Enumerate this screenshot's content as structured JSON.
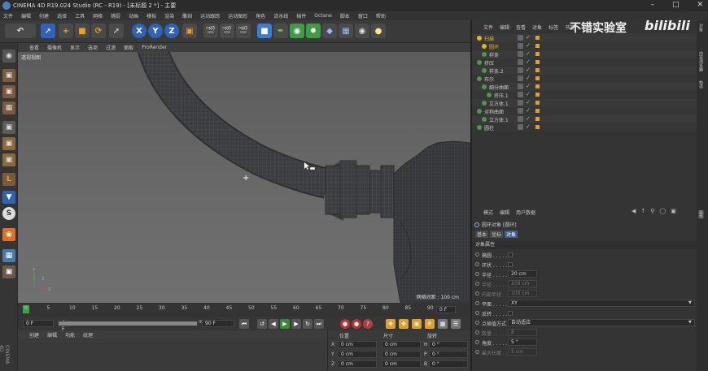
{
  "window": {
    "title": "CINEMA 4D R19.024 Studio (RC - R19) - [未标题 2 *] - 主要"
  },
  "menu": [
    "文件",
    "编辑",
    "创建",
    "选择",
    "工具",
    "网格",
    "捕捉",
    "动画",
    "模拟",
    "渲染",
    "雕刻",
    "运动跟踪",
    "运动图形",
    "角色",
    "流水线",
    "插件",
    "Octane",
    "脚本",
    "窗口",
    "帮助"
  ],
  "watermark": {
    "text": "不错实验室",
    "brand": "bilibili"
  },
  "viewport": {
    "menu": [
      "查看",
      "摄像机",
      "显示",
      "选项",
      "过滤",
      "面板",
      "ProRender"
    ],
    "label": "透视视图",
    "grid_info": "网格间距 : 100 cm"
  },
  "timeline": {
    "ticks": [
      "0",
      "5",
      "10",
      "15",
      "20",
      "25",
      "30",
      "35",
      "40",
      "45",
      "50",
      "55",
      "60",
      "65",
      "70",
      "75",
      "80",
      "85",
      "90"
    ],
    "end_frame": "0 F"
  },
  "playbar": {
    "start": "0 F",
    "current": "0 F",
    "range_end": "90 F",
    "end": "90 F"
  },
  "material": {
    "menu": [
      "创建",
      "编辑",
      "功能",
      "纹理"
    ]
  },
  "coords": {
    "headers": [
      "位置",
      "尺寸",
      "旋转"
    ],
    "rows": [
      {
        "axis": "X",
        "pos": "0 cm",
        "size": "0 cm",
        "rot_axis": "H",
        "rot": "0 °"
      },
      {
        "axis": "Y",
        "pos": "0 cm",
        "size": "0 cm",
        "rot_axis": "P",
        "rot": "0 °"
      },
      {
        "axis": "Z",
        "pos": "0 cm",
        "size": "0 cm",
        "rot_axis": "B",
        "rot": "0 °"
      }
    ]
  },
  "object_manager": {
    "menu": [
      "文件",
      "编辑",
      "查看",
      "对象",
      "标签",
      "书签"
    ],
    "items": [
      {
        "label": "扫描",
        "depth": 0,
        "color": "#e6b422"
      },
      {
        "label": "圆环",
        "depth": 1,
        "color": "#e6b422"
      },
      {
        "label": "样条",
        "depth": 1,
        "color": "#c8c8c8"
      },
      {
        "label": "挤压",
        "depth": 0,
        "color": "#c8c8c8"
      },
      {
        "label": "样条.2",
        "depth": 1,
        "color": "#c8c8c8"
      },
      {
        "label": "布尔",
        "depth": 0,
        "color": "#c8c8c8"
      },
      {
        "label": "细分曲面",
        "depth": 1,
        "color": "#c8c8c8"
      },
      {
        "label": "挤压.1",
        "depth": 2,
        "color": "#c8c8c8"
      },
      {
        "label": "立方体.1",
        "depth": 1,
        "color": "#c8c8c8"
      },
      {
        "label": "对称曲面",
        "depth": 0,
        "color": "#c8c8c8"
      },
      {
        "label": "立方体.1",
        "depth": 1,
        "color": "#c8c8c8"
      },
      {
        "label": "圆柱",
        "depth": 0,
        "color": "#c8c8c8"
      }
    ]
  },
  "attributes": {
    "menu": [
      "模式",
      "编辑",
      "用户数据"
    ],
    "object_title": "圆环对象 [圆环]",
    "tabs": [
      "基本",
      "坐标",
      "对象"
    ],
    "section": "对象属性",
    "props": [
      {
        "label": "椭圆 . . . . . .",
        "value": "",
        "type": "check"
      },
      {
        "label": "环状 . . . . . .",
        "value": "",
        "type": "check"
      },
      {
        "label": "半径 . . . . . .",
        "value": "20 cm",
        "type": "field"
      },
      {
        "label": "半径 . . . . . .",
        "value": "200 cm",
        "type": "dim"
      },
      {
        "label": "内部半径 . . .",
        "value": "100 cm",
        "type": "dim"
      },
      {
        "label": "平面 . . . . . .",
        "value": "XY",
        "type": "select"
      },
      {
        "label": "反转 . . . . . .",
        "value": "",
        "type": "check"
      },
      {
        "label": "点插值方式",
        "value": "自动适应",
        "type": "select"
      },
      {
        "label": "数量 . . . . . .",
        "value": "8",
        "type": "dim"
      },
      {
        "label": "角度 . . . . . .",
        "value": "5 °",
        "type": "field"
      },
      {
        "label": "最大长度 . . .",
        "value": "5 cm",
        "type": "dim"
      }
    ]
  },
  "right_tabs": [
    "对象",
    "内容浏览器",
    "构造",
    "属性"
  ],
  "colors": {
    "accent_blue": "#4b7fc9",
    "active_tab": "#3d5f8f",
    "yellow": "#e6b422"
  }
}
